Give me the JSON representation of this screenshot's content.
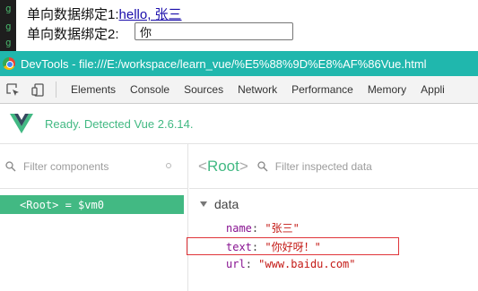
{
  "page": {
    "row1_label": "单向数据绑定1:",
    "row1_value": "hello, 张三",
    "row2_label": "单向数据绑定2:",
    "row2_input_value": "你"
  },
  "devtools": {
    "window_title": "DevTools - file:///E:/workspace/learn_vue/%E5%88%9D%E8%AF%86Vue.html",
    "tabs": [
      "Elements",
      "Console",
      "Sources",
      "Network",
      "Performance",
      "Memory",
      "Appli"
    ]
  },
  "vue": {
    "status": "Ready. Detected Vue 2.6.14.",
    "filter_components_placeholder": "Filter components",
    "root_item_label": "<Root> = $vm0",
    "selected_component": "Root",
    "filter_inspected_placeholder": "Filter inspected data",
    "data_section": "data",
    "props": [
      {
        "key": "name",
        "value": "\"张三\""
      },
      {
        "key": "text",
        "value": "\"你好呀！\""
      },
      {
        "key": "url",
        "value": "\"www.baidu.com\""
      }
    ]
  },
  "colors": {
    "titlebar": "#20b7ad",
    "vue_green": "#42b983",
    "highlight_border": "#e0353a"
  }
}
